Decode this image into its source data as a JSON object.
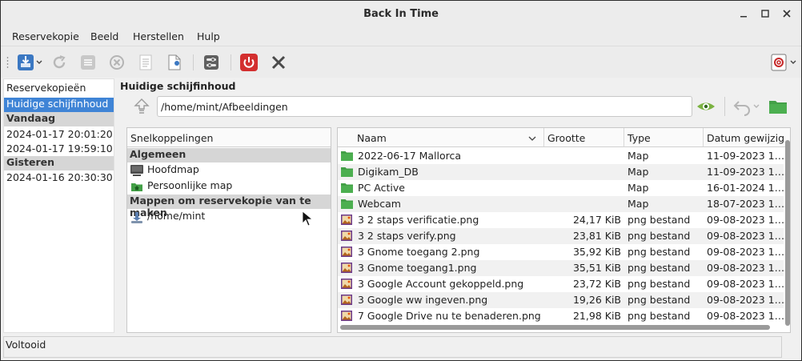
{
  "window": {
    "title": "Back In Time"
  },
  "menu": [
    "Reservekopie",
    "Beeld",
    "Herstellen",
    "Hulp"
  ],
  "snapshots": {
    "header": "Reservekopieën",
    "current": "Huidige schijfinhoud",
    "groups": [
      {
        "label": "Vandaag",
        "items": [
          "2024-01-17 20:01:20",
          "2024-01-17 19:59:10"
        ]
      },
      {
        "label": "Gisteren",
        "items": [
          "2024-01-16 20:30:30"
        ]
      }
    ]
  },
  "main": {
    "title": "Huidige schijfinhoud",
    "path": "/home/mint/Afbeeldingen"
  },
  "shortcuts": {
    "header": "Snelkoppelingen",
    "general_label": "Algemeen",
    "general": [
      {
        "label": "Hoofdmap",
        "icon": "computer-icon"
      },
      {
        "label": "Persoonlijke map",
        "icon": "home-folder-icon"
      }
    ],
    "backup_label": "Mappen om reservekopie van te maken",
    "backup": [
      {
        "label": "/home/mint",
        "icon": "drive-icon"
      }
    ]
  },
  "files": {
    "columns": {
      "name": "Naam",
      "size": "Grootte",
      "type": "Type",
      "date": "Datum gewijzig"
    },
    "rows": [
      {
        "name": "2022-06-17 Mallorca",
        "size": "",
        "type": "Map",
        "date": "11-09-2023 1…",
        "kind": "folder"
      },
      {
        "name": "Digikam_DB",
        "size": "",
        "type": "Map",
        "date": "11-09-2023 1…",
        "kind": "folder"
      },
      {
        "name": "PC Active",
        "size": "",
        "type": "Map",
        "date": "16-01-2024 1…",
        "kind": "folder"
      },
      {
        "name": "Webcam",
        "size": "",
        "type": "Map",
        "date": "18-07-2023 1…",
        "kind": "folder"
      },
      {
        "name": "3 2 staps verificatie.png",
        "size": "24,17 KiB",
        "type": "png bestand",
        "date": "09-08-2023 1…",
        "kind": "image"
      },
      {
        "name": "3 2 staps verify.png",
        "size": "23,81 KiB",
        "type": "png bestand",
        "date": "09-08-2023 1…",
        "kind": "image"
      },
      {
        "name": "3 Gnome toegang 2.png",
        "size": "35,92 KiB",
        "type": "png bestand",
        "date": "09-08-2023 1…",
        "kind": "image"
      },
      {
        "name": "3 Gnome toegang1.png",
        "size": "35,51 KiB",
        "type": "png bestand",
        "date": "09-08-2023 1…",
        "kind": "image"
      },
      {
        "name": "3 Google Account gekoppeld.png",
        "size": "23,72 KiB",
        "type": "png bestand",
        "date": "09-08-2023 1…",
        "kind": "image"
      },
      {
        "name": "3 Google ww ingeven.png",
        "size": "19,26 KiB",
        "type": "png bestand",
        "date": "09-08-2023 1…",
        "kind": "image"
      },
      {
        "name": "7 Google Drive nu te benaderen.png",
        "size": "21,98 KiB",
        "type": "png bestand",
        "date": "09-08-2023 1…",
        "kind": "image"
      }
    ]
  },
  "status": "Voltooid",
  "colors": {
    "selection": "#3f84d6",
    "folder": "#4caf50",
    "power": "#d32f2f"
  }
}
